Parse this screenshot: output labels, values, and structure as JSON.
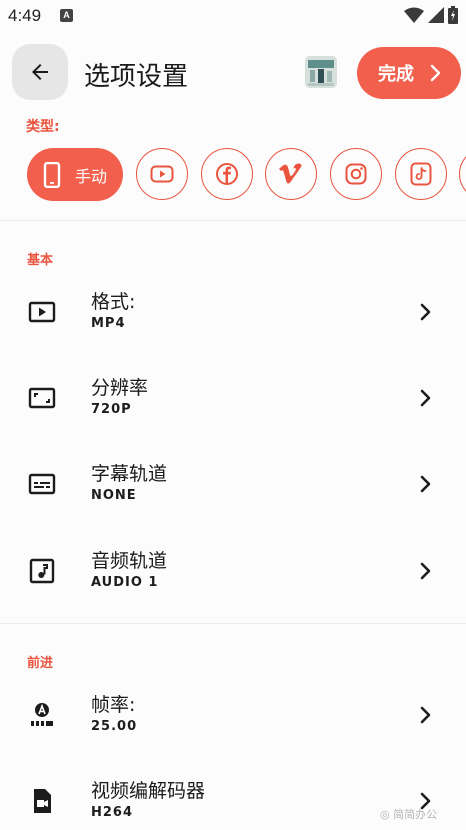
{
  "status_bar": {
    "time": "4:49",
    "notification_letter": "A"
  },
  "app_bar": {
    "title": "选项设置",
    "done_label": "完成"
  },
  "type_section": {
    "label": "类型:",
    "active_chip_label": "手动",
    "platforms": [
      "phone-icon",
      "youtube-icon",
      "facebook-icon",
      "vimeo-icon",
      "instagram-icon",
      "tiktok-icon"
    ]
  },
  "basic_section": {
    "label": "基本",
    "items": [
      {
        "title": "格式:",
        "value": "MP4",
        "icon": "play-box-icon"
      },
      {
        "title": "分辨率",
        "value": "720P",
        "icon": "aspect-ratio-icon"
      },
      {
        "title": "字幕轨道",
        "value": "NONE",
        "icon": "subtitles-icon"
      },
      {
        "title": "音频轨道",
        "value": "AUDIO 1",
        "icon": "music-note-icon"
      }
    ]
  },
  "advanced_section": {
    "label": "前进",
    "items": [
      {
        "title": "帧率:",
        "value": "25.00",
        "icon": "frame-rate-icon"
      },
      {
        "title": "视频编解码器",
        "value": "H264",
        "icon": "video-file-icon"
      }
    ]
  },
  "watermark": "◎ 简简办公",
  "colors": {
    "accent": "#f25f4c",
    "accent_text": "#e9553f",
    "back_button_bg": "#e6e6e6"
  }
}
